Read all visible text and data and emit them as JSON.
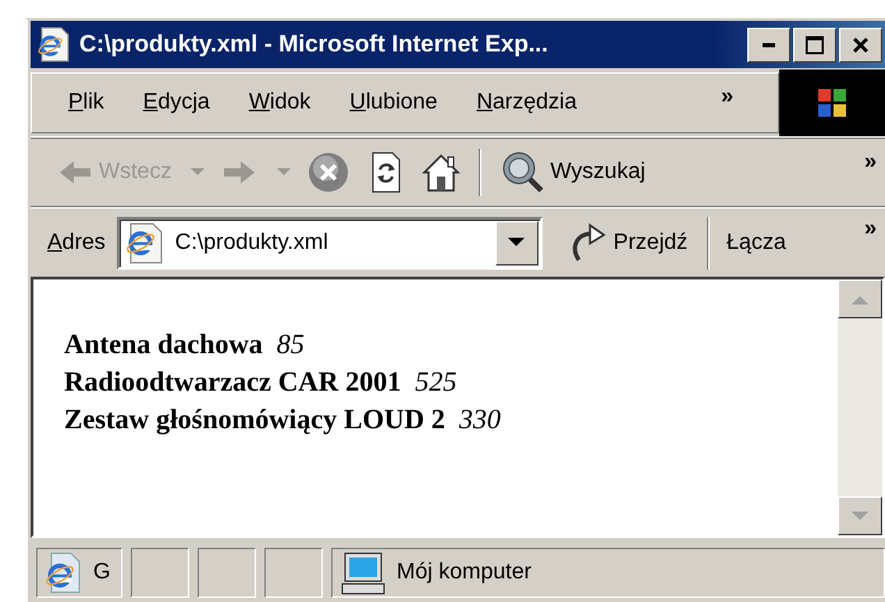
{
  "window": {
    "title": "C:\\produkty.xml - Microsoft Internet Exp..."
  },
  "menu": {
    "items": [
      {
        "label": "Plik"
      },
      {
        "label": "Edycja"
      },
      {
        "label": "Widok"
      },
      {
        "label": "Ulubione"
      },
      {
        "label": "Narzędzia"
      }
    ],
    "chevron": "»"
  },
  "toolbar": {
    "items": [
      {
        "kind": "back",
        "label": "Wstecz",
        "disabled": true
      },
      {
        "kind": "dropdown",
        "disabled": true
      },
      {
        "kind": "forward",
        "disabled": true
      },
      {
        "kind": "dropdown",
        "disabled": true
      },
      {
        "kind": "stop",
        "disabled": false
      },
      {
        "kind": "refresh",
        "disabled": false
      },
      {
        "kind": "home",
        "disabled": false
      },
      {
        "kind": "separator"
      },
      {
        "kind": "search",
        "label": "Wyszukaj",
        "disabled": false
      }
    ],
    "chevron": "»"
  },
  "address_bar": {
    "label": "Adres",
    "value": "C:\\produkty.xml",
    "go": "Przejdź",
    "links": "Łącza",
    "chevron": "»"
  },
  "content": {
    "products": [
      {
        "name": "Antena dachowa",
        "price": "85"
      },
      {
        "name": "Radioodtwarzacz CAR 2001",
        "price": "525"
      },
      {
        "name": "Zestaw głośnomówiący LOUD 2",
        "price": "330"
      }
    ]
  },
  "status_bar": {
    "panes": [
      {
        "kind": "page",
        "label": "G"
      },
      {
        "kind": "blank"
      },
      {
        "kind": "blank"
      },
      {
        "kind": "blank"
      },
      {
        "kind": "zone",
        "label": "Mój komputer"
      }
    ]
  }
}
